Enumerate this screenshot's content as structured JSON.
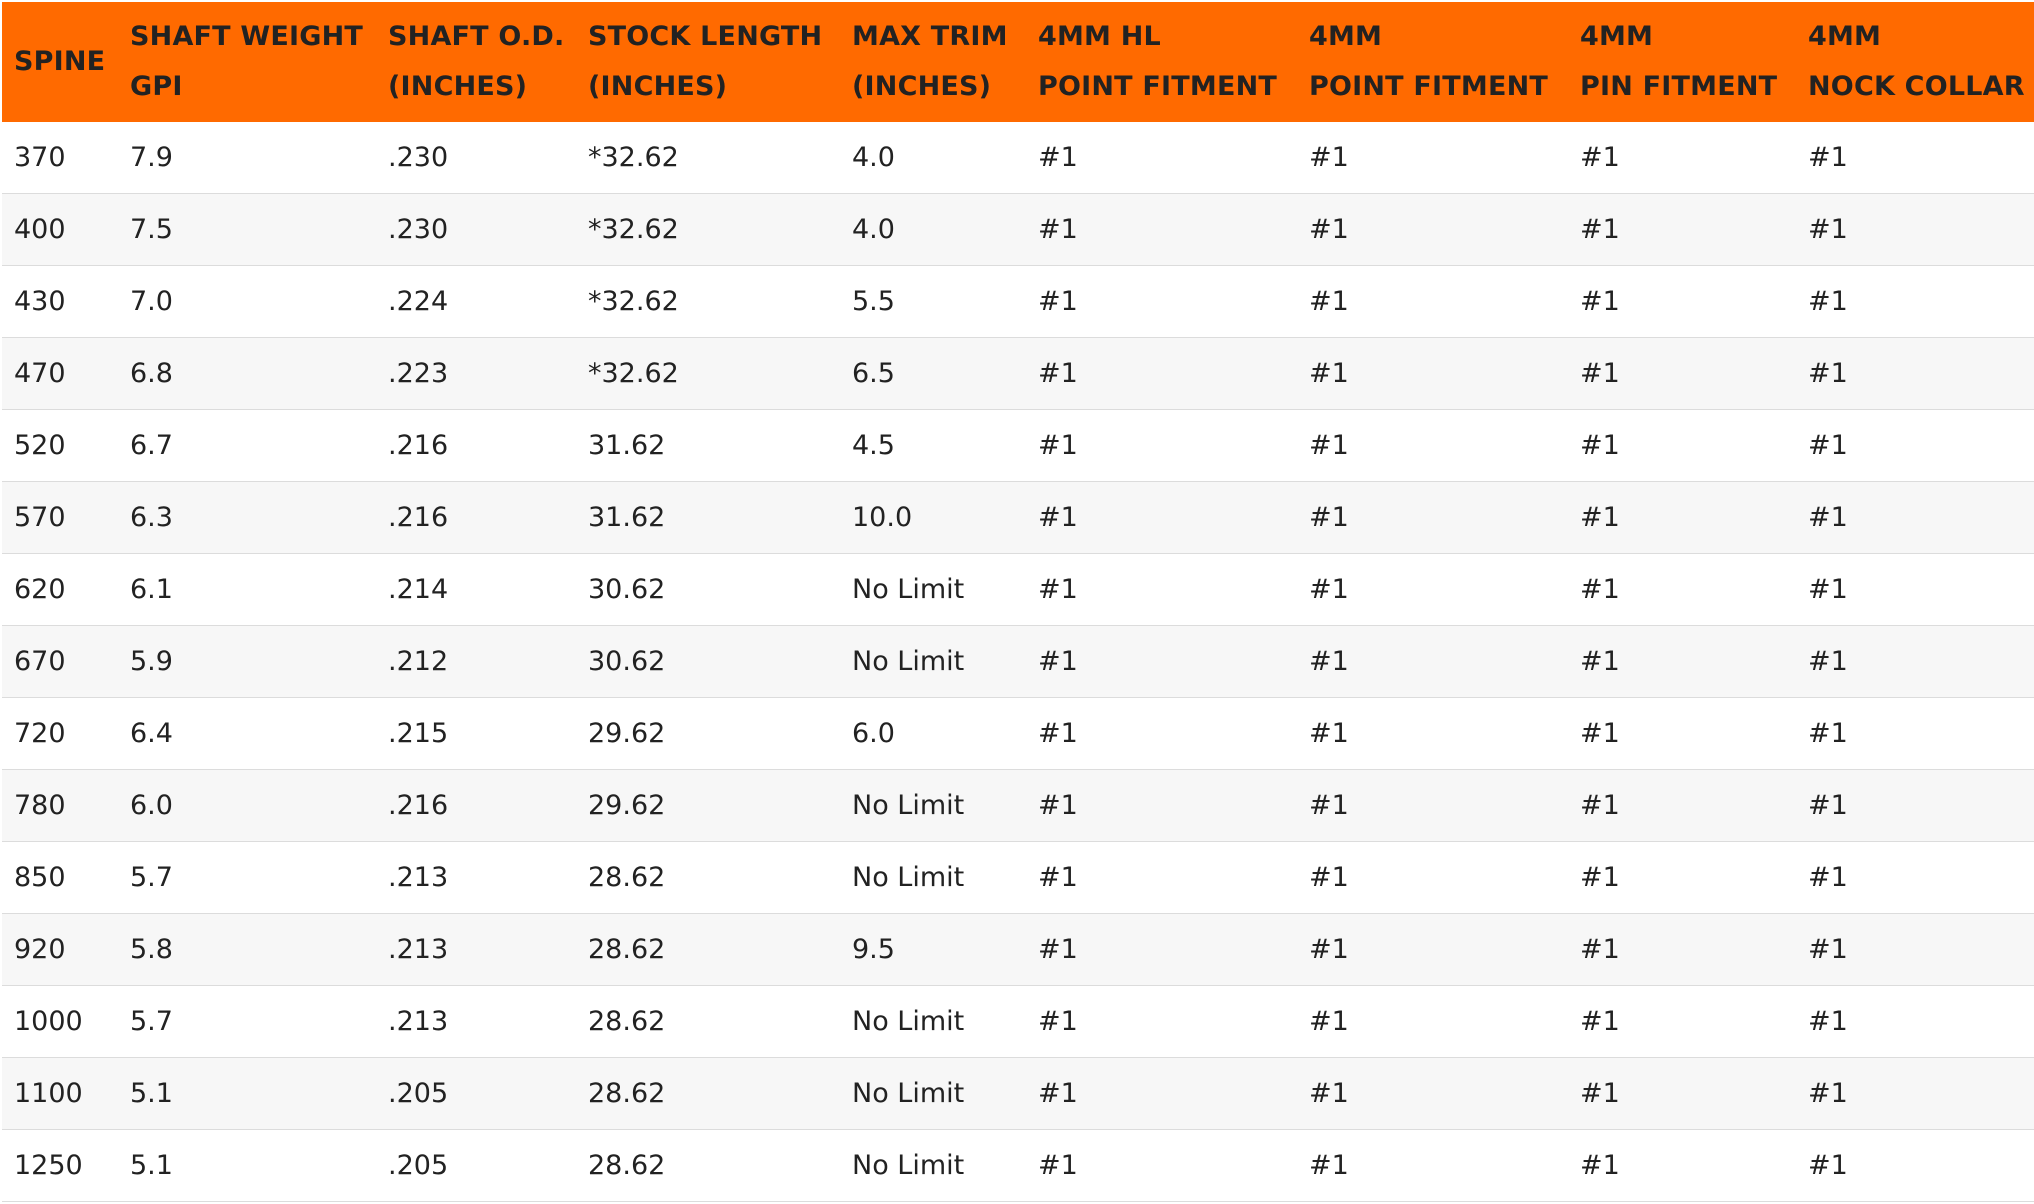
{
  "colors": {
    "header_bg": "#ff6a00",
    "header_text": "#222222",
    "row_alt": "#f7f7f7",
    "divider": "#dcdcdc"
  },
  "table": {
    "columns": [
      {
        "line1": "SPINE",
        "line2": ""
      },
      {
        "line1": "SHAFT WEIGHT",
        "line2": "GPI"
      },
      {
        "line1": "SHAFT O.D.",
        "line2": "(INCHES)"
      },
      {
        "line1": "STOCK LENGTH",
        "line2": "(INCHES)"
      },
      {
        "line1": "MAX TRIM",
        "line2": "(INCHES)"
      },
      {
        "line1": "4MM HL",
        "line2": "POINT FITMENT"
      },
      {
        "line1": "4MM",
        "line2": "POINT FITMENT"
      },
      {
        "line1": "4MM",
        "line2": "PIN FITMENT"
      },
      {
        "line1": "4MM",
        "line2": "NOCK COLLAR"
      }
    ],
    "rows": [
      [
        "370",
        "7.9",
        ".230",
        "*32.62",
        "4.0",
        "#1",
        "#1",
        "#1",
        "#1"
      ],
      [
        "400",
        "7.5",
        ".230",
        "*32.62",
        "4.0",
        "#1",
        "#1",
        "#1",
        "#1"
      ],
      [
        "430",
        "7.0",
        ".224",
        "*32.62",
        "5.5",
        "#1",
        "#1",
        "#1",
        "#1"
      ],
      [
        "470",
        "6.8",
        ".223",
        "*32.62",
        "6.5",
        "#1",
        "#1",
        "#1",
        "#1"
      ],
      [
        "520",
        "6.7",
        ".216",
        "31.62",
        "4.5",
        "#1",
        "#1",
        "#1",
        "#1"
      ],
      [
        "570",
        "6.3",
        ".216",
        "31.62",
        "10.0",
        "#1",
        "#1",
        "#1",
        "#1"
      ],
      [
        "620",
        "6.1",
        ".214",
        "30.62",
        "No Limit",
        "#1",
        "#1",
        "#1",
        "#1"
      ],
      [
        "670",
        "5.9",
        ".212",
        "30.62",
        "No Limit",
        "#1",
        "#1",
        "#1",
        "#1"
      ],
      [
        "720",
        "6.4",
        ".215",
        "29.62",
        "6.0",
        "#1",
        "#1",
        "#1",
        "#1"
      ],
      [
        "780",
        "6.0",
        ".216",
        "29.62",
        "No Limit",
        "#1",
        "#1",
        "#1",
        "#1"
      ],
      [
        "850",
        "5.7",
        ".213",
        "28.62",
        "No Limit",
        "#1",
        "#1",
        "#1",
        "#1"
      ],
      [
        "920",
        "5.8",
        ".213",
        "28.62",
        "9.5",
        "#1",
        "#1",
        "#1",
        "#1"
      ],
      [
        "1000",
        "5.7",
        ".213",
        "28.62",
        "No Limit",
        "#1",
        "#1",
        "#1",
        "#1"
      ],
      [
        "1100",
        "5.1",
        ".205",
        "28.62",
        "No Limit",
        "#1",
        "#1",
        "#1",
        "#1"
      ],
      [
        "1250",
        "5.1",
        ".205",
        "28.62",
        "No Limit",
        "#1",
        "#1",
        "#1",
        "#1"
      ]
    ]
  }
}
